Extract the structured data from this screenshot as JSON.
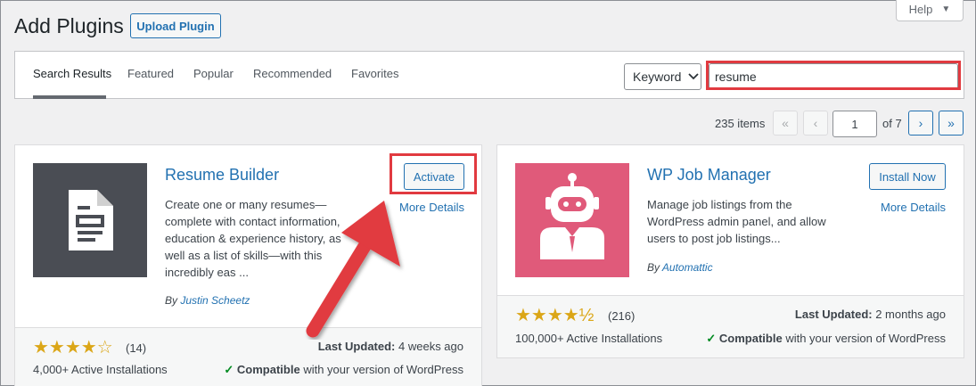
{
  "header": {
    "title": "Add Plugins",
    "upload_label": "Upload Plugin",
    "help_label": "Help"
  },
  "tabs": [
    {
      "label": "Search Results"
    },
    {
      "label": "Featured"
    },
    {
      "label": "Popular"
    },
    {
      "label": "Recommended"
    },
    {
      "label": "Favorites"
    }
  ],
  "search": {
    "type_label": "Keyword",
    "query": "resume"
  },
  "pagination": {
    "items": "235 items",
    "first": "«",
    "prev": "‹",
    "current": "1",
    "of_label": "of 7",
    "next": "›",
    "last": "»"
  },
  "plugins": [
    {
      "name": "Resume Builder",
      "action": "Activate",
      "more": "More Details",
      "description": "Create one or many resumes—complete with contact information, education & experience history, as well as a list of skills—with this incredibly eas ...",
      "by": "By",
      "author": "Justin Scheetz",
      "stars": "★★★★☆",
      "rating_count": "(14)",
      "installs": "4,000+ Active Installations",
      "last_updated_label": "Last Updated:",
      "last_updated": "4 weeks ago",
      "compatible_label": "Compatible",
      "compatible_text": "with your version of WordPress",
      "icon_color": "#4a4d54"
    },
    {
      "name": "WP Job Manager",
      "action": "Install Now",
      "more": "More Details",
      "description": "Manage job listings from the WordPress admin panel, and allow users to post job listings...",
      "by": "By",
      "author": "Automattic",
      "stars": "★★★★½",
      "rating_count": "(216)",
      "installs": "100,000+ Active Installations",
      "last_updated_label": "Last Updated:",
      "last_updated": "2 months ago",
      "compatible_label": "Compatible",
      "compatible_text": "with your version of WordPress",
      "icon_color": "#e05a7a"
    }
  ],
  "colors": {
    "accent": "#2271b1",
    "annotation_red": "#e13a40",
    "star": "#dba617"
  }
}
